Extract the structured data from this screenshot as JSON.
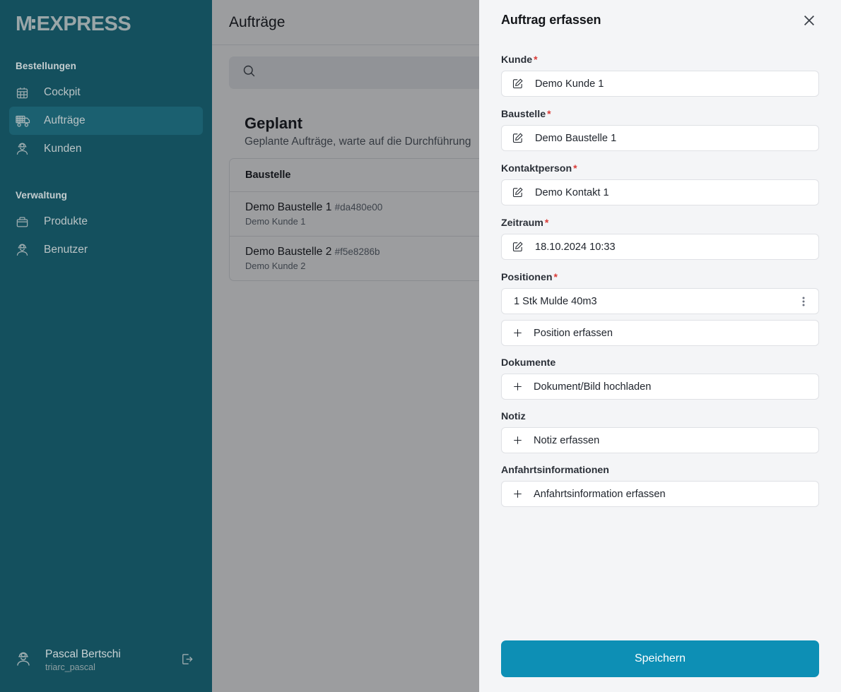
{
  "app": {
    "logo_left": "M",
    "logo_right": "EXPRESS"
  },
  "sidebar": {
    "sections": [
      {
        "title": "Bestellungen",
        "items": [
          {
            "label": "Cockpit",
            "icon": "calendar-icon",
            "active": false
          },
          {
            "label": "Aufträge",
            "icon": "truck-icon",
            "active": true
          },
          {
            "label": "Kunden",
            "icon": "worker-icon",
            "active": false
          }
        ]
      },
      {
        "title": "Verwaltung",
        "items": [
          {
            "label": "Produkte",
            "icon": "package-icon",
            "active": false
          },
          {
            "label": "Benutzer",
            "icon": "worker-icon",
            "active": false
          }
        ]
      }
    ],
    "user": {
      "name": "Pascal Bertschi",
      "handle": "triarc_pascal",
      "avatar_icon": "worker-icon",
      "logout_icon": "logout-icon"
    },
    "colors": {
      "background": "#14505e",
      "active_background": "#1b6070",
      "text": "#b9c3c5"
    }
  },
  "main": {
    "header_title": "Aufträge",
    "search": {
      "placeholder": "",
      "value": "",
      "icon": "search-icon"
    },
    "section": {
      "title": "Geplant",
      "subtitle": "Geplante Aufträge, warte auf die Durchführung"
    },
    "table": {
      "columns": [
        "Baustelle"
      ],
      "rows": [
        {
          "name": "Demo Baustelle 1",
          "code": "#da480e00",
          "customer": "Demo Kunde 1"
        },
        {
          "name": "Demo Baustelle 2",
          "code": "#f5e8286b",
          "customer": "Demo Kunde 2"
        }
      ]
    }
  },
  "panel": {
    "title": "Auftrag erfassen",
    "close_icon": "close-icon",
    "fields": [
      {
        "label": "Kunde",
        "required": true,
        "icon": "edit-icon",
        "value": "Demo Kunde 1"
      },
      {
        "label": "Baustelle",
        "required": true,
        "icon": "edit-icon",
        "value": "Demo Baustelle 1"
      },
      {
        "label": "Kontaktperson",
        "required": true,
        "icon": "edit-icon",
        "value": "Demo Kontakt 1"
      },
      {
        "label": "Zeitraum",
        "required": true,
        "icon": "edit-icon",
        "value": "18.10.2024 10:33"
      }
    ],
    "positionen": {
      "label": "Positionen",
      "required": true,
      "items": [
        {
          "value": "1 Stk Mulde 40m3",
          "menu_icon": "kebab-menu-icon"
        }
      ],
      "add_label": "Position erfassen",
      "add_icon": "plus-icon"
    },
    "dokumente": {
      "label": "Dokumente",
      "required": false,
      "add_label": "Dokument/Bild hochladen",
      "add_icon": "plus-icon"
    },
    "notiz": {
      "label": "Notiz",
      "required": false,
      "add_label": "Notiz erfassen",
      "add_icon": "plus-icon"
    },
    "anfahrt": {
      "label": "Anfahrtsinformationen",
      "required": false,
      "add_label": "Anfahrtsinformation erfassen",
      "add_icon": "plus-icon"
    },
    "save_label": "Speichern",
    "colors": {
      "background": "#f4f5f7",
      "save_button": "#0d8fb5",
      "required_marker": "#d93a36"
    }
  }
}
